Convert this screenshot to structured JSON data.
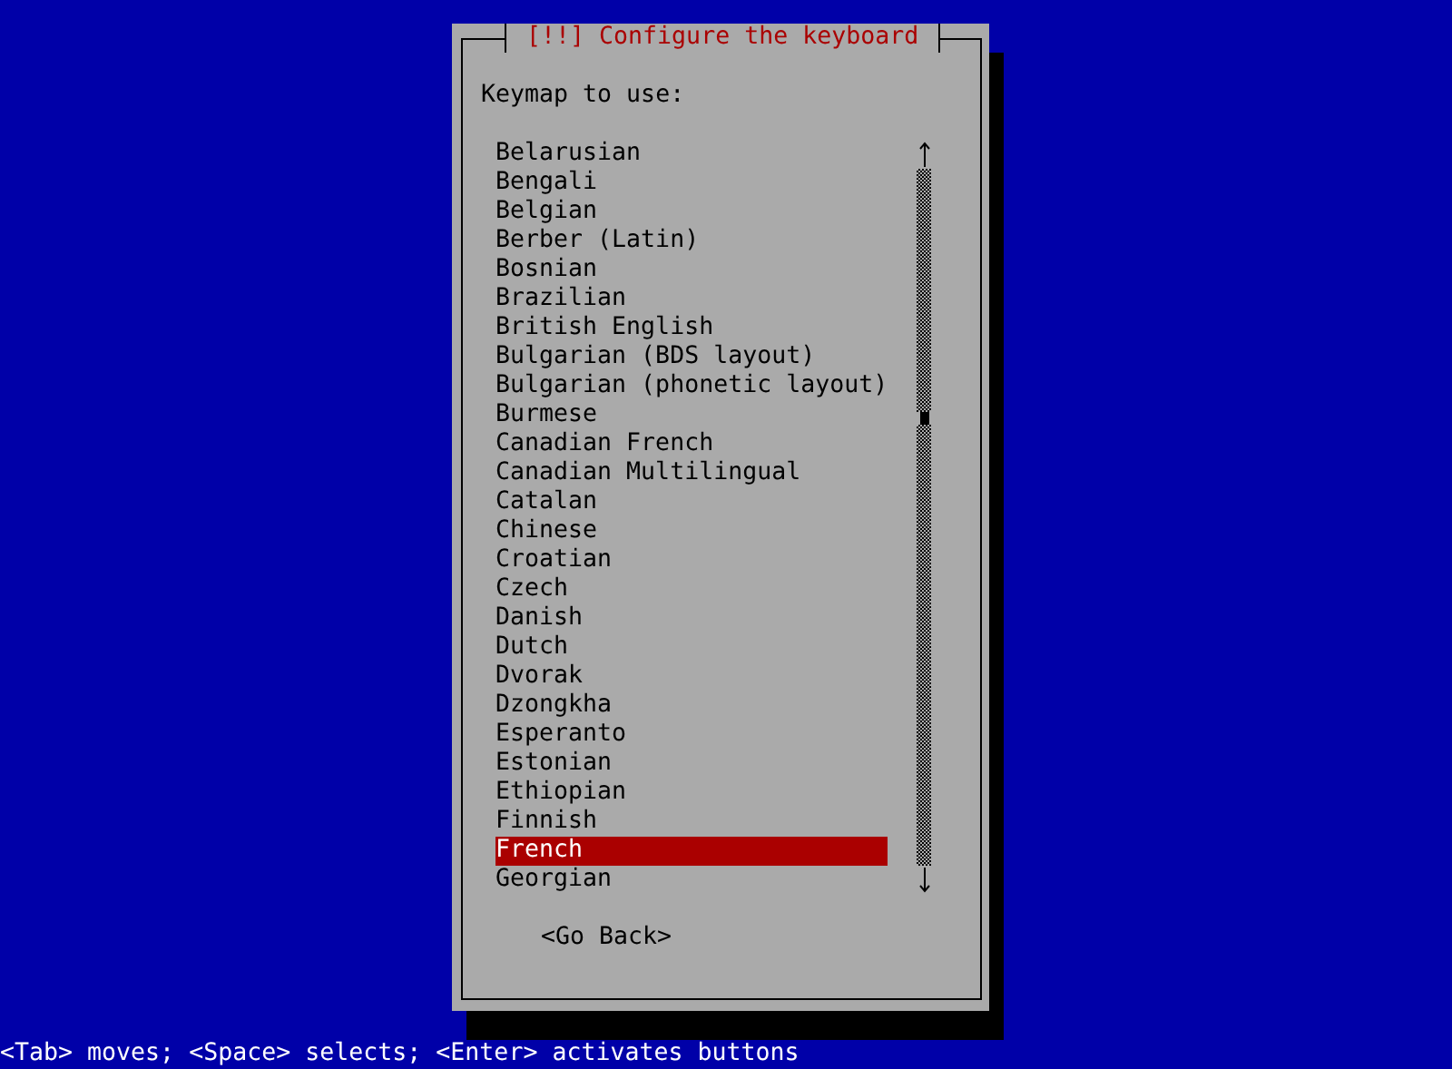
{
  "dialog": {
    "title": "[!!] Configure the keyboard",
    "prompt": "Keymap to use:",
    "items": [
      {
        "label": "Belarusian",
        "selected": false
      },
      {
        "label": "Bengali",
        "selected": false
      },
      {
        "label": "Belgian",
        "selected": false
      },
      {
        "label": "Berber (Latin)",
        "selected": false
      },
      {
        "label": "Bosnian",
        "selected": false
      },
      {
        "label": "Brazilian",
        "selected": false
      },
      {
        "label": "British English",
        "selected": false
      },
      {
        "label": "Bulgarian (BDS layout)",
        "selected": false
      },
      {
        "label": "Bulgarian (phonetic layout)",
        "selected": false
      },
      {
        "label": "Burmese",
        "selected": false
      },
      {
        "label": "Canadian French",
        "selected": false
      },
      {
        "label": "Canadian Multilingual",
        "selected": false
      },
      {
        "label": "Catalan",
        "selected": false
      },
      {
        "label": "Chinese",
        "selected": false
      },
      {
        "label": "Croatian",
        "selected": false
      },
      {
        "label": "Czech",
        "selected": false
      },
      {
        "label": "Danish",
        "selected": false
      },
      {
        "label": "Dutch",
        "selected": false
      },
      {
        "label": "Dvorak",
        "selected": false
      },
      {
        "label": "Dzongkha",
        "selected": false
      },
      {
        "label": "Esperanto",
        "selected": false
      },
      {
        "label": "Estonian",
        "selected": false
      },
      {
        "label": "Ethiopian",
        "selected": false
      },
      {
        "label": "Finnish",
        "selected": false
      },
      {
        "label": "French",
        "selected": true
      },
      {
        "label": "Georgian",
        "selected": false
      }
    ],
    "button": "<Go Back>"
  },
  "status_bar": "<Tab> moves; <Space> selects; <Enter> activates buttons"
}
